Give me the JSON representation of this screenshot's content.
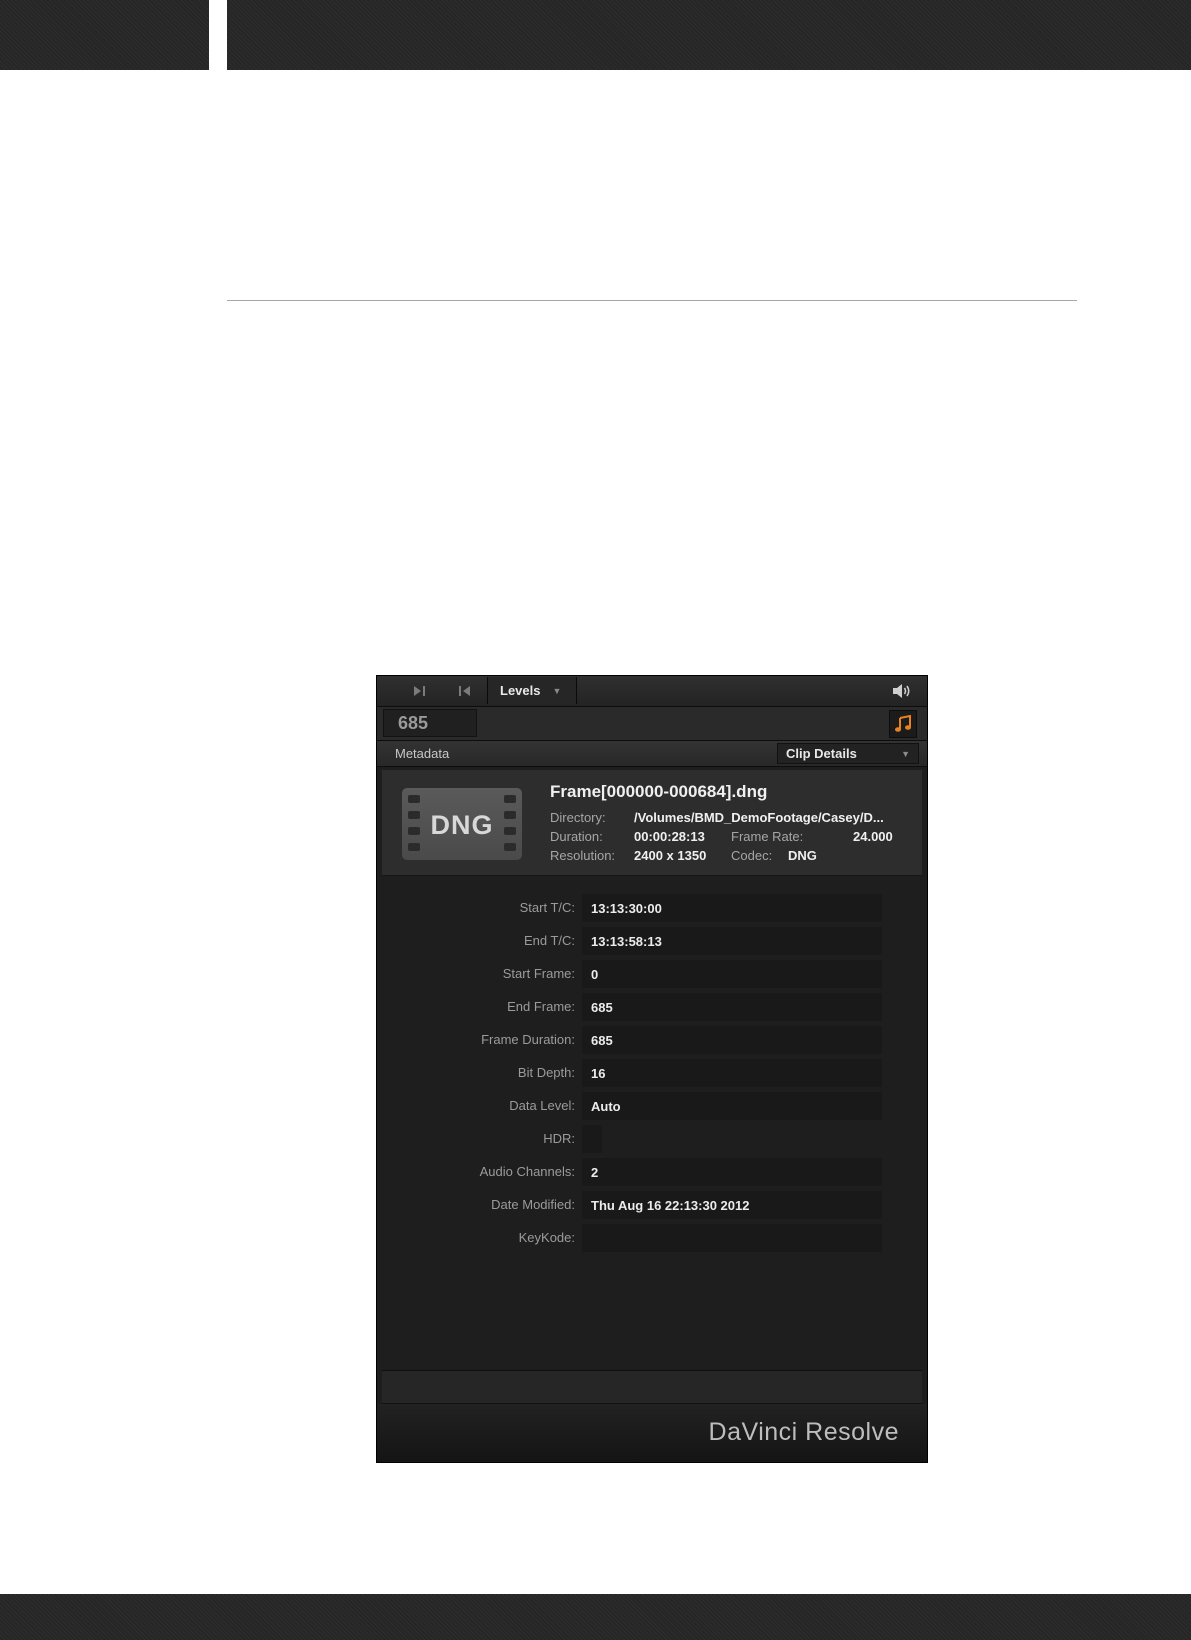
{
  "toolbar": {
    "levels_label": "Levels",
    "frame_count": "685"
  },
  "metadata": {
    "header_label": "Metadata",
    "view_select": "Clip Details"
  },
  "clip": {
    "thumb_label": "DNG",
    "file_name": "Frame[000000-000684].dng",
    "directory_label": "Directory:",
    "directory_value": "/Volumes/BMD_DemoFootage/Casey/D...",
    "duration_label": "Duration:",
    "duration_value": "00:00:28:13",
    "frame_rate_label": "Frame Rate:",
    "frame_rate_value": "24.000",
    "resolution_label": "Resolution:",
    "resolution_value": "2400 x 1350",
    "codec_label": "Codec:",
    "codec_value": "DNG"
  },
  "fields": {
    "start_tc": {
      "label": "Start T/C:",
      "value": "13:13:30:00"
    },
    "end_tc": {
      "label": "End T/C:",
      "value": "13:13:58:13"
    },
    "start_frame": {
      "label": "Start Frame:",
      "value": "0"
    },
    "end_frame": {
      "label": "End Frame:",
      "value": "685"
    },
    "frame_duration": {
      "label": "Frame Duration:",
      "value": "685"
    },
    "bit_depth": {
      "label": "Bit Depth:",
      "value": "16"
    },
    "data_level": {
      "label": "Data Level:",
      "value": "Auto"
    },
    "hdr": {
      "label": "HDR:",
      "value": ""
    },
    "audio_channels": {
      "label": "Audio Channels:",
      "value": "2"
    },
    "date_modified": {
      "label": "Date Modified:",
      "value": "Thu Aug 16 22:13:30 2012"
    },
    "keykode": {
      "label": "KeyKode:",
      "value": ""
    }
  },
  "footer": {
    "brand": "DaVinci Resolve"
  },
  "colors": {
    "accent": "#e8821e",
    "panel_bg": "#1e1e1e",
    "page_band": "#262626"
  }
}
